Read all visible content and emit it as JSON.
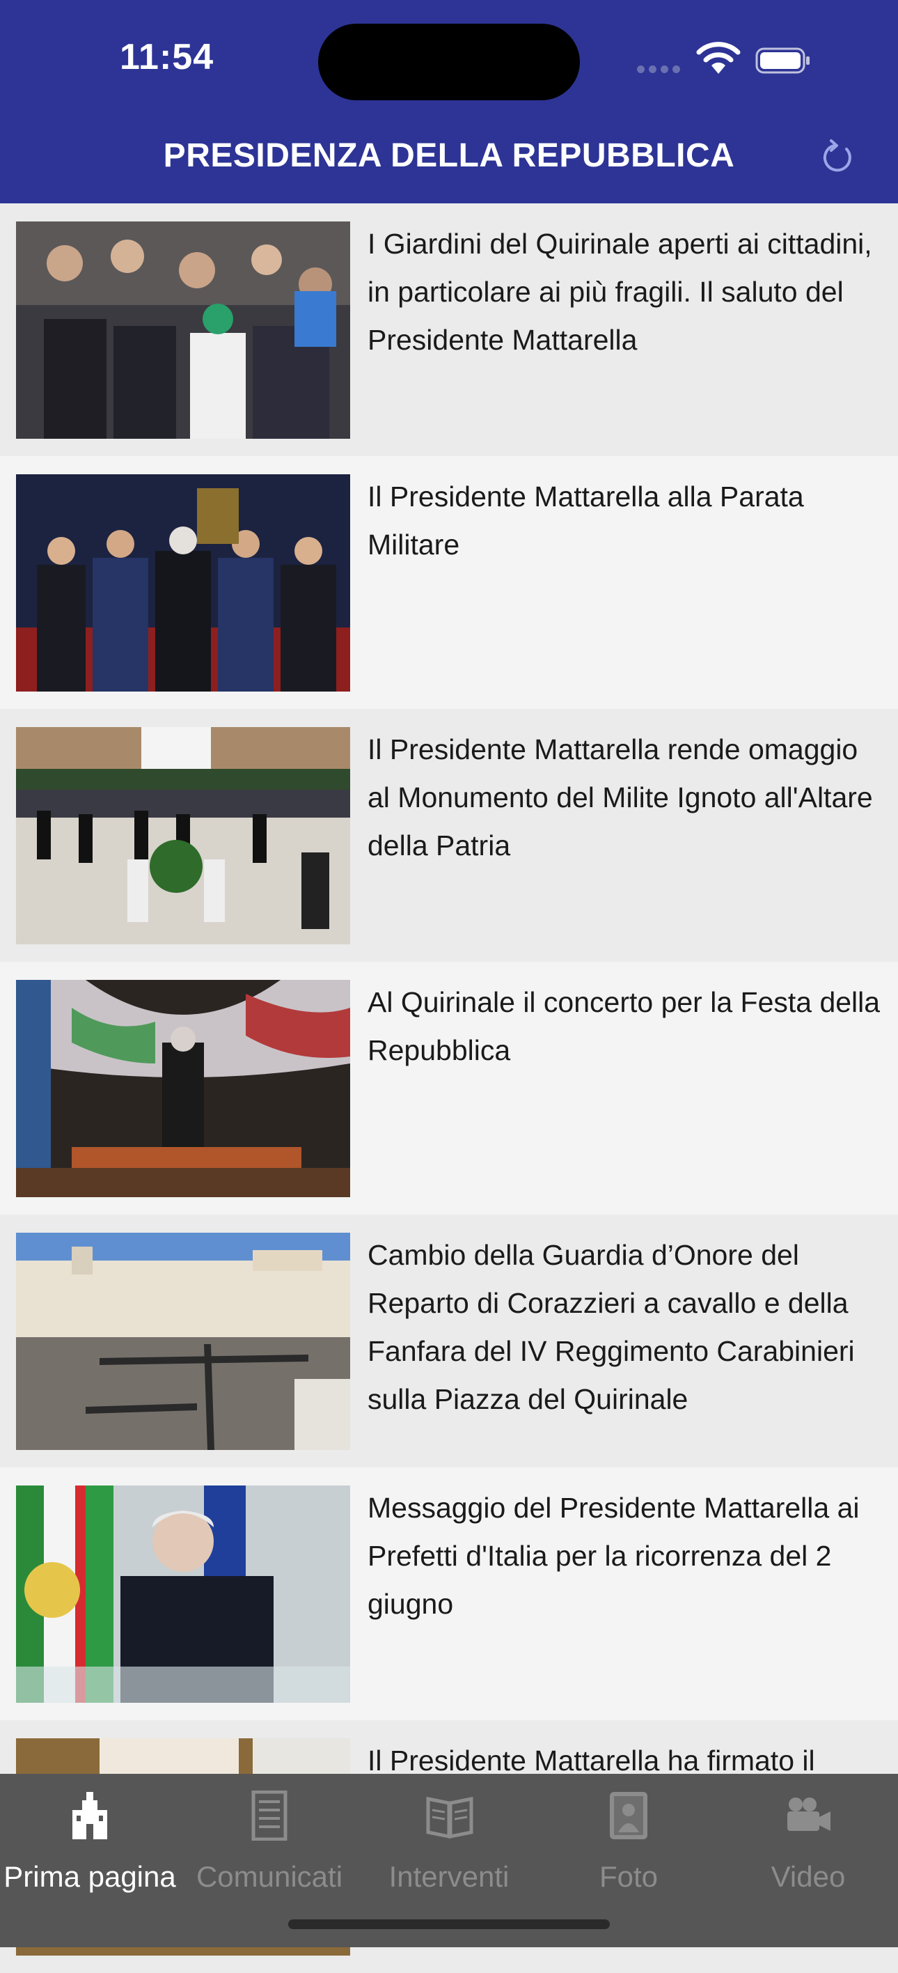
{
  "status_bar": {
    "time": "11:54"
  },
  "header": {
    "title": "PRESIDENZA DELLA REPUBBLICA"
  },
  "news": [
    {
      "title": "I Giardini del Quirinale aperti ai cittadini, in particolare ai più fragili. Il saluto del Presidente Mattarella"
    },
    {
      "title": "Il Presidente Mattarella alla Parata Militare"
    },
    {
      "title": "Il Presidente Mattarella rende omaggio al Monumento del Milite Ignoto all'Altare della Patria"
    },
    {
      "title": "Al Quirinale il concerto per la Festa della Repubblica"
    },
    {
      "title": "Cambio della Guardia d’Onore del Reparto di  Corazzieri a cavallo e della Fanfara del IV Reggimento Carabinieri sulla Piazza del Quirinale"
    },
    {
      "title": "Messaggio del Presidente Mattarella ai Prefetti d'Italia per la ricorrenza del 2 giugno"
    },
    {
      "title": "Il Presidente Mattarella ha firmato il"
    }
  ],
  "tabs": [
    {
      "label": "Prima pagina",
      "icon": "building-icon",
      "active": true
    },
    {
      "label": "Comunicati",
      "icon": "document-icon",
      "active": false
    },
    {
      "label": "Interventi",
      "icon": "book-icon",
      "active": false
    },
    {
      "label": "Foto",
      "icon": "photo-icon",
      "active": false
    },
    {
      "label": "Video",
      "icon": "video-camera-icon",
      "active": false
    }
  ],
  "colors": {
    "header_bg": "#2d3495",
    "tabbar_bg": "#565656",
    "tab_active": "#ffffff",
    "tab_inactive": "#8c8c8c"
  }
}
